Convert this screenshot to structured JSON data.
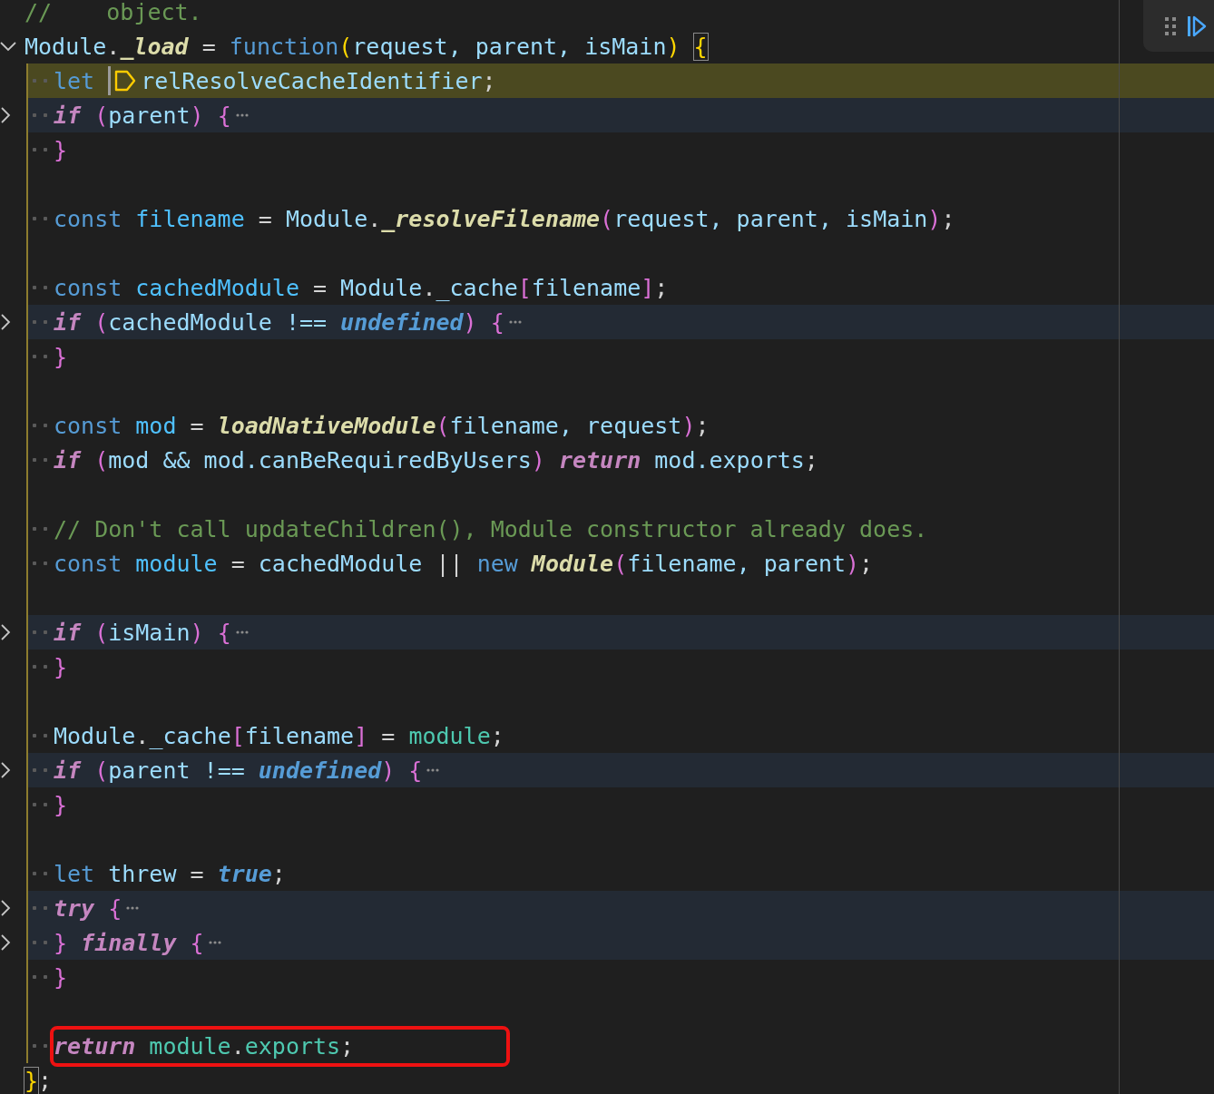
{
  "code_lines": [
    {
      "kind": "code",
      "tokens": [
        {
          "text": "//    object.",
          "kind": "comment"
        }
      ]
    },
    {
      "kind": "code",
      "foldable": true,
      "collapsed": false,
      "tokens": [
        {
          "text": "Module",
          "kind": "var"
        },
        {
          "text": ".",
          "kind": "punct"
        },
        {
          "text": "_load",
          "kind": "fn-em"
        },
        {
          "text": " = ",
          "kind": "punct"
        },
        {
          "text": "function",
          "kind": "storage"
        },
        {
          "text": "(",
          "kind": "bracket-y"
        },
        {
          "text": "request, parent, isMain",
          "kind": "var"
        },
        {
          "text": ") ",
          "kind": "bracket-y"
        },
        {
          "text": "{",
          "kind": "bracket-y",
          "matched": true
        }
      ],
      "children": [
        {
          "kind": "code",
          "current": true,
          "tokens": [
            {
              "text": "let ",
              "kind": "storage"
            },
            {
              "kind": "marker"
            },
            {
              "text": "relResolveCacheIdentifier",
              "kind": "var"
            },
            {
              "text": ";",
              "kind": "punct"
            }
          ]
        },
        {
          "kind": "code",
          "foldable": true,
          "collapsed": true,
          "tokens": [
            {
              "text": "if ",
              "kind": "control"
            },
            {
              "text": "(",
              "kind": "bracket-p"
            },
            {
              "text": "parent",
              "kind": "var"
            },
            {
              "text": ") {",
              "kind": "bracket-p"
            }
          ]
        },
        {
          "kind": "code",
          "tokens": [
            {
              "text": "}",
              "kind": "bracket-p"
            }
          ]
        },
        {
          "kind": "blank"
        },
        {
          "kind": "code",
          "tokens": [
            {
              "text": "const ",
              "kind": "storage"
            },
            {
              "text": "filename",
              "kind": "const-var"
            },
            {
              "text": " = ",
              "kind": "punct"
            },
            {
              "text": "Module",
              "kind": "var"
            },
            {
              "text": ".",
              "kind": "punct"
            },
            {
              "text": "_resolveFilename",
              "kind": "fn-em"
            },
            {
              "text": "(",
              "kind": "bracket-p"
            },
            {
              "text": "request, parent, isMain",
              "kind": "var"
            },
            {
              "text": ")",
              "kind": "bracket-p"
            },
            {
              "text": ";",
              "kind": "punct"
            }
          ]
        },
        {
          "kind": "blank"
        },
        {
          "kind": "code",
          "tokens": [
            {
              "text": "const ",
              "kind": "storage"
            },
            {
              "text": "cachedModule",
              "kind": "const-var"
            },
            {
              "text": " = ",
              "kind": "punct"
            },
            {
              "text": "Module",
              "kind": "var"
            },
            {
              "text": ".",
              "kind": "punct"
            },
            {
              "text": "_cache",
              "kind": "var"
            },
            {
              "text": "[",
              "kind": "bracket-p"
            },
            {
              "text": "filename",
              "kind": "var"
            },
            {
              "text": "]",
              "kind": "bracket-p"
            },
            {
              "text": ";",
              "kind": "punct"
            }
          ]
        },
        {
          "kind": "code",
          "foldable": true,
          "collapsed": true,
          "tokens": [
            {
              "text": "if ",
              "kind": "control"
            },
            {
              "text": "(",
              "kind": "bracket-p"
            },
            {
              "text": "cachedModule !== ",
              "kind": "var"
            },
            {
              "text": "undefined",
              "kind": "literal"
            },
            {
              "text": ") {",
              "kind": "bracket-p"
            }
          ]
        },
        {
          "kind": "code",
          "tokens": [
            {
              "text": "}",
              "kind": "bracket-p"
            }
          ]
        },
        {
          "kind": "blank"
        },
        {
          "kind": "code",
          "tokens": [
            {
              "text": "const ",
              "kind": "storage"
            },
            {
              "text": "mod",
              "kind": "const-var"
            },
            {
              "text": " = ",
              "kind": "punct"
            },
            {
              "text": "loadNativeModule",
              "kind": "fn-em"
            },
            {
              "text": "(",
              "kind": "bracket-p"
            },
            {
              "text": "filename, request",
              "kind": "var"
            },
            {
              "text": ")",
              "kind": "bracket-p"
            },
            {
              "text": ";",
              "kind": "punct"
            }
          ]
        },
        {
          "kind": "code",
          "tokens": [
            {
              "text": "if ",
              "kind": "control"
            },
            {
              "text": "(",
              "kind": "bracket-p"
            },
            {
              "text": "mod && mod.canBeRequiredByUsers",
              "kind": "var"
            },
            {
              "text": ") ",
              "kind": "bracket-p"
            },
            {
              "text": "return ",
              "kind": "control"
            },
            {
              "text": "mod.exports",
              "kind": "var"
            },
            {
              "text": ";",
              "kind": "punct"
            }
          ]
        },
        {
          "kind": "blank"
        },
        {
          "kind": "code",
          "tokens": [
            {
              "text": "// Don't call updateChildren(), Module constructor already does.",
              "kind": "comment"
            }
          ]
        },
        {
          "kind": "code",
          "tokens": [
            {
              "text": "const ",
              "kind": "storage"
            },
            {
              "text": "module",
              "kind": "const-var"
            },
            {
              "text": " = ",
              "kind": "punct"
            },
            {
              "text": "cachedModule",
              "kind": "var"
            },
            {
              "text": " || ",
              "kind": "punct"
            },
            {
              "text": "new ",
              "kind": "storage"
            },
            {
              "text": "Module",
              "kind": "fn-em"
            },
            {
              "text": "(",
              "kind": "bracket-p"
            },
            {
              "text": "filename, parent",
              "kind": "var"
            },
            {
              "text": ")",
              "kind": "bracket-p"
            },
            {
              "text": ";",
              "kind": "punct"
            }
          ]
        },
        {
          "kind": "blank"
        },
        {
          "kind": "code",
          "foldable": true,
          "collapsed": true,
          "tokens": [
            {
              "text": "if ",
              "kind": "control"
            },
            {
              "text": "(",
              "kind": "bracket-p"
            },
            {
              "text": "isMain",
              "kind": "var"
            },
            {
              "text": ") {",
              "kind": "bracket-p"
            }
          ]
        },
        {
          "kind": "code",
          "tokens": [
            {
              "text": "}",
              "kind": "bracket-p"
            }
          ]
        },
        {
          "kind": "blank"
        },
        {
          "kind": "code",
          "tokens": [
            {
              "text": "Module",
              "kind": "var"
            },
            {
              "text": ".",
              "kind": "punct"
            },
            {
              "text": "_cache",
              "kind": "var"
            },
            {
              "text": "[",
              "kind": "bracket-p"
            },
            {
              "text": "filename",
              "kind": "var"
            },
            {
              "text": "]",
              "kind": "bracket-p"
            },
            {
              "text": " = ",
              "kind": "punct"
            },
            {
              "text": "module",
              "kind": "teal"
            },
            {
              "text": ";",
              "kind": "punct"
            }
          ]
        },
        {
          "kind": "code",
          "foldable": true,
          "collapsed": true,
          "tokens": [
            {
              "text": "if ",
              "kind": "control"
            },
            {
              "text": "(",
              "kind": "bracket-p"
            },
            {
              "text": "parent !== ",
              "kind": "var"
            },
            {
              "text": "undefined",
              "kind": "literal"
            },
            {
              "text": ") {",
              "kind": "bracket-p"
            }
          ]
        },
        {
          "kind": "code",
          "tokens": [
            {
              "text": "}",
              "kind": "bracket-p"
            }
          ]
        },
        {
          "kind": "blank"
        },
        {
          "kind": "code",
          "tokens": [
            {
              "text": "let ",
              "kind": "storage"
            },
            {
              "text": "threw",
              "kind": "var"
            },
            {
              "text": " = ",
              "kind": "punct"
            },
            {
              "text": "true",
              "kind": "literal"
            },
            {
              "text": ";",
              "kind": "punct"
            }
          ]
        },
        {
          "kind": "code",
          "foldable": true,
          "collapsed": true,
          "tokens": [
            {
              "text": "try ",
              "kind": "control"
            },
            {
              "text": "{",
              "kind": "bracket-p"
            }
          ]
        },
        {
          "kind": "code",
          "foldable": true,
          "collapsed": true,
          "tokens": [
            {
              "text": "} ",
              "kind": "bracket-p"
            },
            {
              "text": "finally ",
              "kind": "control"
            },
            {
              "text": "{",
              "kind": "bracket-p"
            }
          ]
        },
        {
          "kind": "code",
          "tokens": [
            {
              "text": "}",
              "kind": "bracket-p"
            }
          ]
        },
        {
          "kind": "blank"
        },
        {
          "kind": "code",
          "annotated": true,
          "tokens": [
            {
              "text": "return ",
              "kind": "control"
            },
            {
              "text": "module",
              "kind": "teal"
            },
            {
              "text": ".",
              "kind": "punct"
            },
            {
              "text": "exports",
              "kind": "teal"
            },
            {
              "text": ";",
              "kind": "punct"
            }
          ]
        }
      ]
    },
    {
      "kind": "code",
      "tokens": [
        {
          "text": "}",
          "kind": "bracket-y",
          "matched": true
        },
        {
          "text": ";",
          "kind": "punct"
        }
      ]
    }
  ]
}
